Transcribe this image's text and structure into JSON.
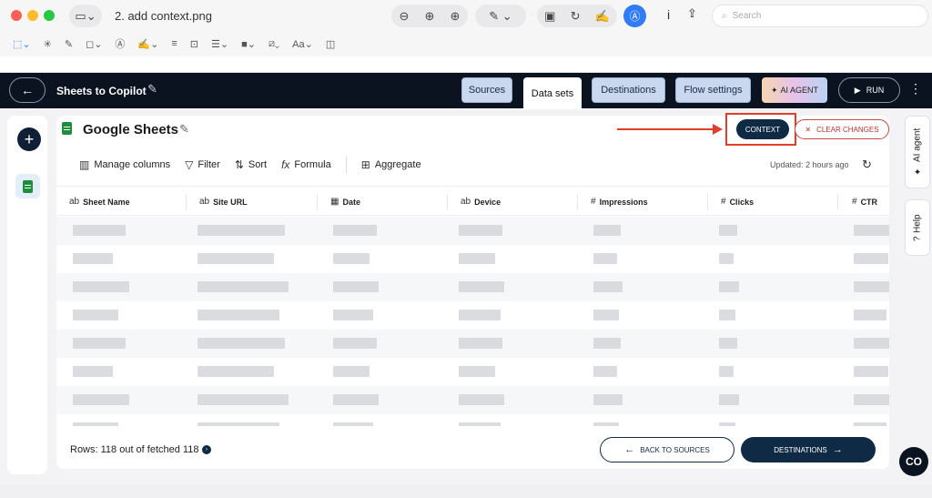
{
  "window": {
    "title": "2. add context.png",
    "search_placeholder": "Search",
    "info_label": "i"
  },
  "header": {
    "flow_title": "Sheets to Copilot",
    "nav": [
      "Sources",
      "Data sets",
      "Destinations",
      "Flow settings"
    ],
    "ai_agent_label": "AI AGENT",
    "run_label": "RUN"
  },
  "dataset": {
    "title": "Google Sheets",
    "context_label": "CONTEXT",
    "clear_label": "CLEAR CHANGES"
  },
  "tools": {
    "manage_columns": "Manage columns",
    "filter": "Filter",
    "sort": "Sort",
    "formula": "Formula",
    "aggregate": "Aggregate",
    "updated": "Updated: 2 hours ago"
  },
  "table": {
    "columns": [
      {
        "label": "Sheet Name",
        "type_icon": "ab"
      },
      {
        "label": "Site URL",
        "type_icon": "ab"
      },
      {
        "label": "Date",
        "type_icon": "calendar"
      },
      {
        "label": "Device",
        "type_icon": "ab"
      },
      {
        "label": "Impressions",
        "type_icon": "#"
      },
      {
        "label": "Clicks",
        "type_icon": "#"
      },
      {
        "label": "CTR",
        "type_icon": "#"
      }
    ],
    "visible_rows": 8,
    "cells_obscured": true
  },
  "side": {
    "ai_agent_tab": "AI agent",
    "help_tab": "Help"
  },
  "footer": {
    "rows_text": "Rows: 118 out of fetched 118",
    "back_to_sources": "BACK TO SOURCES",
    "destinations": "DESTINATIONS"
  },
  "colors": {
    "header_bg": "#0b1321",
    "primary": "#0f2a45",
    "annotation_red": "#e0402b",
    "nav_inactive": "#c9d8ee"
  }
}
